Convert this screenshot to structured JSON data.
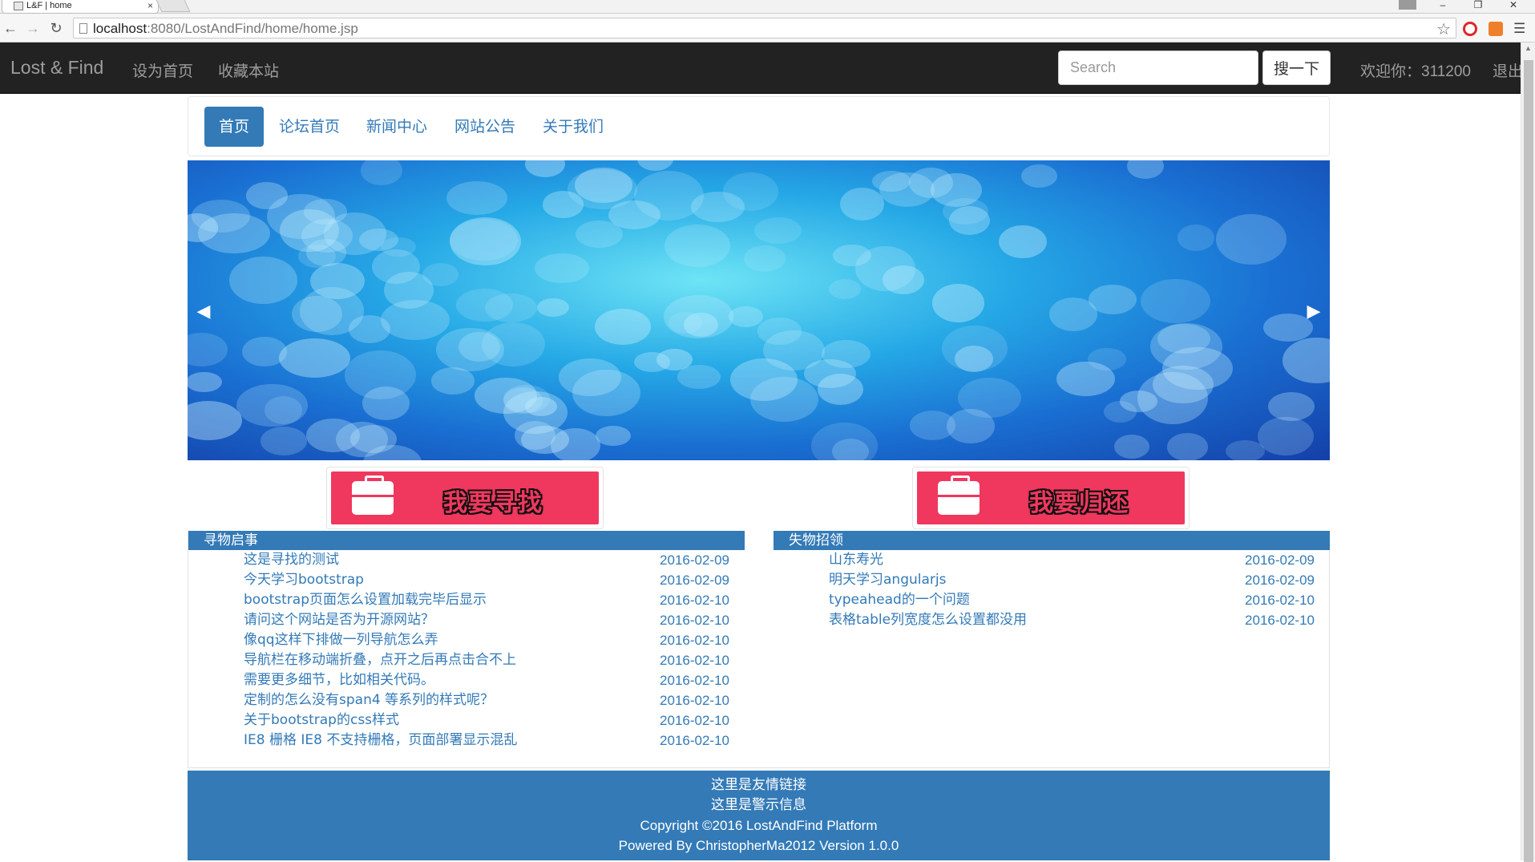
{
  "browser": {
    "tab_title": "L&F | home",
    "tab_close": "×",
    "url_host": "localhost",
    "url_rest": ":8080/LostAndFind/home/home.jsp",
    "win_min": "–",
    "win_max": "❐",
    "win_close": "✕"
  },
  "navbar": {
    "brand": "Lost & Find",
    "links": [
      "设为首页",
      "收藏本站"
    ],
    "search_placeholder": "Search",
    "search_button": "搜一下",
    "welcome": "欢迎你：311200",
    "logout": "退出"
  },
  "pills": [
    "首页",
    "论坛首页",
    "新闻中心",
    "网站公告",
    "关于我们"
  ],
  "buttons": {
    "find": "我要寻找",
    "return": "我要归还"
  },
  "lost_panel": {
    "title": "寻物启事",
    "items": [
      {
        "title": "这是寻找的测试",
        "date": "2016-02-09"
      },
      {
        "title": "今天学习bootstrap",
        "date": "2016-02-09"
      },
      {
        "title": "bootstrap页面怎么设置加载完毕后显示",
        "date": "2016-02-10"
      },
      {
        "title": "请问这个网站是否为开源网站？",
        "date": "2016-02-10"
      },
      {
        "title": "像qq这样下排做一列导航怎么弄",
        "date": "2016-02-10"
      },
      {
        "title": "导航栏在移动端折叠，点开之后再点击合不上",
        "date": "2016-02-10"
      },
      {
        "title": "需要更多细节，比如相关代码。",
        "date": "2016-02-10"
      },
      {
        "title": "定制的怎么没有span4 等系列的样式呢？",
        "date": "2016-02-10"
      },
      {
        "title": "关于bootstrap的css样式",
        "date": "2016-02-10"
      },
      {
        "title": "IE8 栅格 IE8 不支持栅格，页面部署显示混乱",
        "date": "2016-02-10"
      }
    ]
  },
  "found_panel": {
    "title": "失物招领",
    "items": [
      {
        "title": "山东寿光",
        "date": "2016-02-09"
      },
      {
        "title": "明天学习angularjs",
        "date": "2016-02-09"
      },
      {
        "title": "typeahead的一个问题",
        "date": "2016-02-10"
      },
      {
        "title": "表格table列宽度怎么设置都没用",
        "date": "2016-02-10"
      }
    ]
  },
  "footer": {
    "line1": "这里是友情链接",
    "line2": "这里是警示信息",
    "line3": "Copyright ©2016 LostAndFind Platform",
    "line4": "Powered By ChristopherMa2012 Version 1.0.0"
  },
  "colors": {
    "primary": "#337ab7",
    "navbar_bg": "#222222",
    "button_red": "#f0375e"
  },
  "icons": [
    "back-arrow-icon",
    "forward-arrow-icon",
    "reload-icon",
    "star-icon",
    "menu-icon",
    "briefcase-icon",
    "carousel-prev-icon",
    "carousel-next-icon"
  ]
}
